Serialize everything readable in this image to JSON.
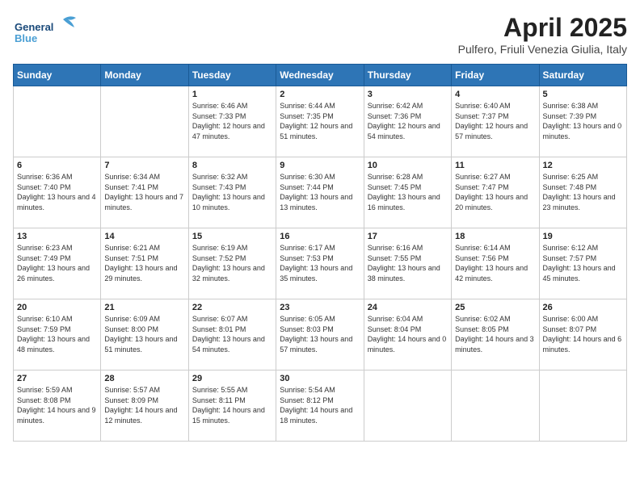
{
  "header": {
    "logo_general": "General",
    "logo_blue": "Blue",
    "title": "April 2025",
    "subtitle": "Pulfero, Friuli Venezia Giulia, Italy"
  },
  "weekdays": [
    "Sunday",
    "Monday",
    "Tuesday",
    "Wednesday",
    "Thursday",
    "Friday",
    "Saturday"
  ],
  "weeks": [
    [
      {
        "day": "",
        "info": ""
      },
      {
        "day": "",
        "info": ""
      },
      {
        "day": "1",
        "info": "Sunrise: 6:46 AM\nSunset: 7:33 PM\nDaylight: 12 hours and 47 minutes."
      },
      {
        "day": "2",
        "info": "Sunrise: 6:44 AM\nSunset: 7:35 PM\nDaylight: 12 hours and 51 minutes."
      },
      {
        "day": "3",
        "info": "Sunrise: 6:42 AM\nSunset: 7:36 PM\nDaylight: 12 hours and 54 minutes."
      },
      {
        "day": "4",
        "info": "Sunrise: 6:40 AM\nSunset: 7:37 PM\nDaylight: 12 hours and 57 minutes."
      },
      {
        "day": "5",
        "info": "Sunrise: 6:38 AM\nSunset: 7:39 PM\nDaylight: 13 hours and 0 minutes."
      }
    ],
    [
      {
        "day": "6",
        "info": "Sunrise: 6:36 AM\nSunset: 7:40 PM\nDaylight: 13 hours and 4 minutes."
      },
      {
        "day": "7",
        "info": "Sunrise: 6:34 AM\nSunset: 7:41 PM\nDaylight: 13 hours and 7 minutes."
      },
      {
        "day": "8",
        "info": "Sunrise: 6:32 AM\nSunset: 7:43 PM\nDaylight: 13 hours and 10 minutes."
      },
      {
        "day": "9",
        "info": "Sunrise: 6:30 AM\nSunset: 7:44 PM\nDaylight: 13 hours and 13 minutes."
      },
      {
        "day": "10",
        "info": "Sunrise: 6:28 AM\nSunset: 7:45 PM\nDaylight: 13 hours and 16 minutes."
      },
      {
        "day": "11",
        "info": "Sunrise: 6:27 AM\nSunset: 7:47 PM\nDaylight: 13 hours and 20 minutes."
      },
      {
        "day": "12",
        "info": "Sunrise: 6:25 AM\nSunset: 7:48 PM\nDaylight: 13 hours and 23 minutes."
      }
    ],
    [
      {
        "day": "13",
        "info": "Sunrise: 6:23 AM\nSunset: 7:49 PM\nDaylight: 13 hours and 26 minutes."
      },
      {
        "day": "14",
        "info": "Sunrise: 6:21 AM\nSunset: 7:51 PM\nDaylight: 13 hours and 29 minutes."
      },
      {
        "day": "15",
        "info": "Sunrise: 6:19 AM\nSunset: 7:52 PM\nDaylight: 13 hours and 32 minutes."
      },
      {
        "day": "16",
        "info": "Sunrise: 6:17 AM\nSunset: 7:53 PM\nDaylight: 13 hours and 35 minutes."
      },
      {
        "day": "17",
        "info": "Sunrise: 6:16 AM\nSunset: 7:55 PM\nDaylight: 13 hours and 38 minutes."
      },
      {
        "day": "18",
        "info": "Sunrise: 6:14 AM\nSunset: 7:56 PM\nDaylight: 13 hours and 42 minutes."
      },
      {
        "day": "19",
        "info": "Sunrise: 6:12 AM\nSunset: 7:57 PM\nDaylight: 13 hours and 45 minutes."
      }
    ],
    [
      {
        "day": "20",
        "info": "Sunrise: 6:10 AM\nSunset: 7:59 PM\nDaylight: 13 hours and 48 minutes."
      },
      {
        "day": "21",
        "info": "Sunrise: 6:09 AM\nSunset: 8:00 PM\nDaylight: 13 hours and 51 minutes."
      },
      {
        "day": "22",
        "info": "Sunrise: 6:07 AM\nSunset: 8:01 PM\nDaylight: 13 hours and 54 minutes."
      },
      {
        "day": "23",
        "info": "Sunrise: 6:05 AM\nSunset: 8:03 PM\nDaylight: 13 hours and 57 minutes."
      },
      {
        "day": "24",
        "info": "Sunrise: 6:04 AM\nSunset: 8:04 PM\nDaylight: 14 hours and 0 minutes."
      },
      {
        "day": "25",
        "info": "Sunrise: 6:02 AM\nSunset: 8:05 PM\nDaylight: 14 hours and 3 minutes."
      },
      {
        "day": "26",
        "info": "Sunrise: 6:00 AM\nSunset: 8:07 PM\nDaylight: 14 hours and 6 minutes."
      }
    ],
    [
      {
        "day": "27",
        "info": "Sunrise: 5:59 AM\nSunset: 8:08 PM\nDaylight: 14 hours and 9 minutes."
      },
      {
        "day": "28",
        "info": "Sunrise: 5:57 AM\nSunset: 8:09 PM\nDaylight: 14 hours and 12 minutes."
      },
      {
        "day": "29",
        "info": "Sunrise: 5:55 AM\nSunset: 8:11 PM\nDaylight: 14 hours and 15 minutes."
      },
      {
        "day": "30",
        "info": "Sunrise: 5:54 AM\nSunset: 8:12 PM\nDaylight: 14 hours and 18 minutes."
      },
      {
        "day": "",
        "info": ""
      },
      {
        "day": "",
        "info": ""
      },
      {
        "day": "",
        "info": ""
      }
    ]
  ]
}
